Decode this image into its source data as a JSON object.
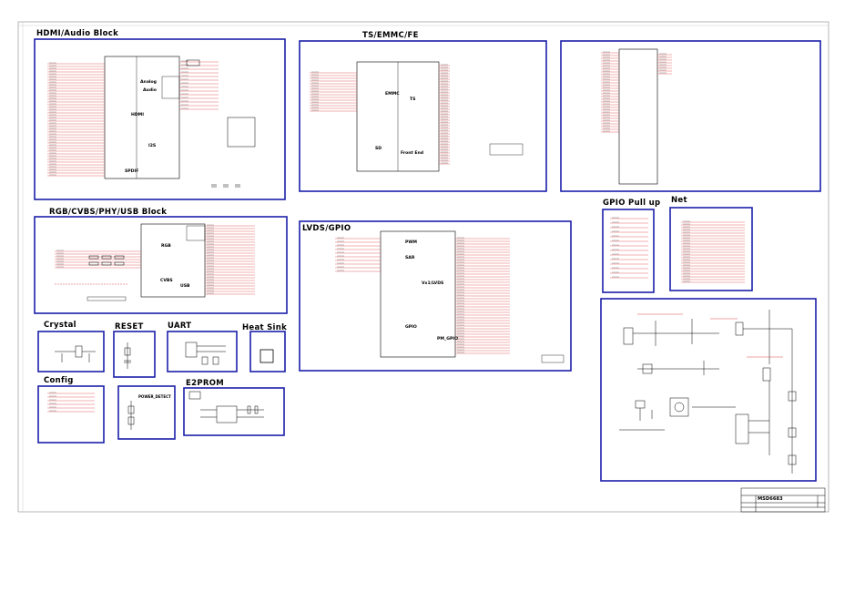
{
  "blocks": {
    "hdmi": {
      "title": "HDMI/Audio Block",
      "labels": [
        "Analog",
        "Audio",
        "HDMI",
        "I2S",
        "SPDIF"
      ]
    },
    "ts": {
      "title": "TS/EMMC/FE",
      "labels": [
        "EMMC",
        "TS",
        "SD",
        "Front End"
      ]
    },
    "rgb": {
      "title": "RGB/CVBS/PHY/USB Block",
      "labels": [
        "RGB",
        "CVBS",
        "USB"
      ]
    },
    "lvds": {
      "title": "LVDS/GPIO",
      "labels": [
        "PWM",
        "SAR",
        "Vx1/LVDS",
        "GPIO",
        "PM_GPIO"
      ]
    },
    "gpio_pullup": {
      "title": "GPIO Pull up"
    },
    "net": {
      "title": "Net"
    },
    "crystal": {
      "title": "Crystal"
    },
    "reset": {
      "title": "RESET"
    },
    "uart": {
      "title": "UART"
    },
    "heatsink": {
      "title": "Heat Sink"
    },
    "config": {
      "title": "Config"
    },
    "eeprom": {
      "title": "E2PROM"
    },
    "power_detect": {
      "label": "POWER_DETECT"
    }
  },
  "title_block": {
    "part": "MSD6683"
  },
  "colors": {
    "frame": "#1b1fa8",
    "wire": "#d42020",
    "ink": "#000000",
    "grid": "#9a9a9a"
  }
}
